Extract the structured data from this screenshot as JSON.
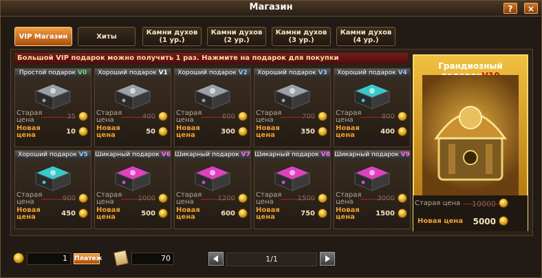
{
  "window": {
    "title": "Магазин",
    "help_label": "?",
    "close_label": "×"
  },
  "tabs": [
    {
      "line1": "VIP Магазин",
      "line2": ""
    },
    {
      "line1": "Хиты",
      "line2": ""
    },
    {
      "line1": "Камни духов",
      "line2": "(1 ур.)"
    },
    {
      "line1": "Камни духов",
      "line2": "(2 ур.)"
    },
    {
      "line1": "Камни духов",
      "line2": "(3 ур.)"
    },
    {
      "line1": "Камни духов",
      "line2": "(4 ур.)"
    }
  ],
  "notice": "Большой VIP подарок можно получить 1 раз. Нажмите на подарок для покупки",
  "labels": {
    "old_word1": "Старая",
    "old_word2": "цена",
    "new_word1": "Новая",
    "new_word2": "цена"
  },
  "items": [
    {
      "name": "Простой подарок",
      "vip": "V0",
      "vip_color": "#6ee06e",
      "old_price": "35",
      "new_price": "10",
      "chest": "grey"
    },
    {
      "name": "Хороший подарок",
      "vip": "V1",
      "vip_color": "#ffffff",
      "old_price": "400",
      "new_price": "50",
      "chest": "grey"
    },
    {
      "name": "Хороший подарок",
      "vip": "V2",
      "vip_color": "#8ec8ff",
      "old_price": "600",
      "new_price": "300",
      "chest": "grey"
    },
    {
      "name": "Хороший подарок",
      "vip": "V3",
      "vip_color": "#8ec8ff",
      "old_price": "700",
      "new_price": "350",
      "chest": "grey"
    },
    {
      "name": "Хороший подарок",
      "vip": "V4",
      "vip_color": "#8ec8ff",
      "old_price": "800",
      "new_price": "400",
      "chest": "teal"
    },
    {
      "name": "Хороший подарок",
      "vip": "V5",
      "vip_color": "#8ec8ff",
      "old_price": "900",
      "new_price": "450",
      "chest": "teal"
    },
    {
      "name": "Шикарный подарок",
      "vip": "V6",
      "vip_color": "#ff66ff",
      "old_price": "1000",
      "new_price": "500",
      "chest": "pink"
    },
    {
      "name": "Шикарный подарок",
      "vip": "V7",
      "vip_color": "#ff66ff",
      "old_price": "1200",
      "new_price": "600",
      "chest": "pink"
    },
    {
      "name": "Шикарный подарок",
      "vip": "V8",
      "vip_color": "#ff66ff",
      "old_price": "1500",
      "new_price": "750",
      "chest": "pink"
    },
    {
      "name": "Шикарный подарок",
      "vip": "V9",
      "vip_color": "#ff66ff",
      "old_price": "3000",
      "new_price": "1500",
      "chest": "pink"
    }
  ],
  "grand": {
    "name": "Грандиозный подарок",
    "vip": "V10",
    "old_label": "Старая цена",
    "old_price": "10000",
    "new_label": "Новая цена",
    "new_price": "5000"
  },
  "footer": {
    "gold_amount": "1",
    "pay_label": "Платеж",
    "voucher_amount": "70",
    "page": "1/1"
  },
  "colors": {
    "chest_grey": "#9aa0a6",
    "chest_teal": "#3ac8c8",
    "chest_pink": "#e040c0",
    "accent": "#f2a040",
    "strike": "#b02020"
  }
}
